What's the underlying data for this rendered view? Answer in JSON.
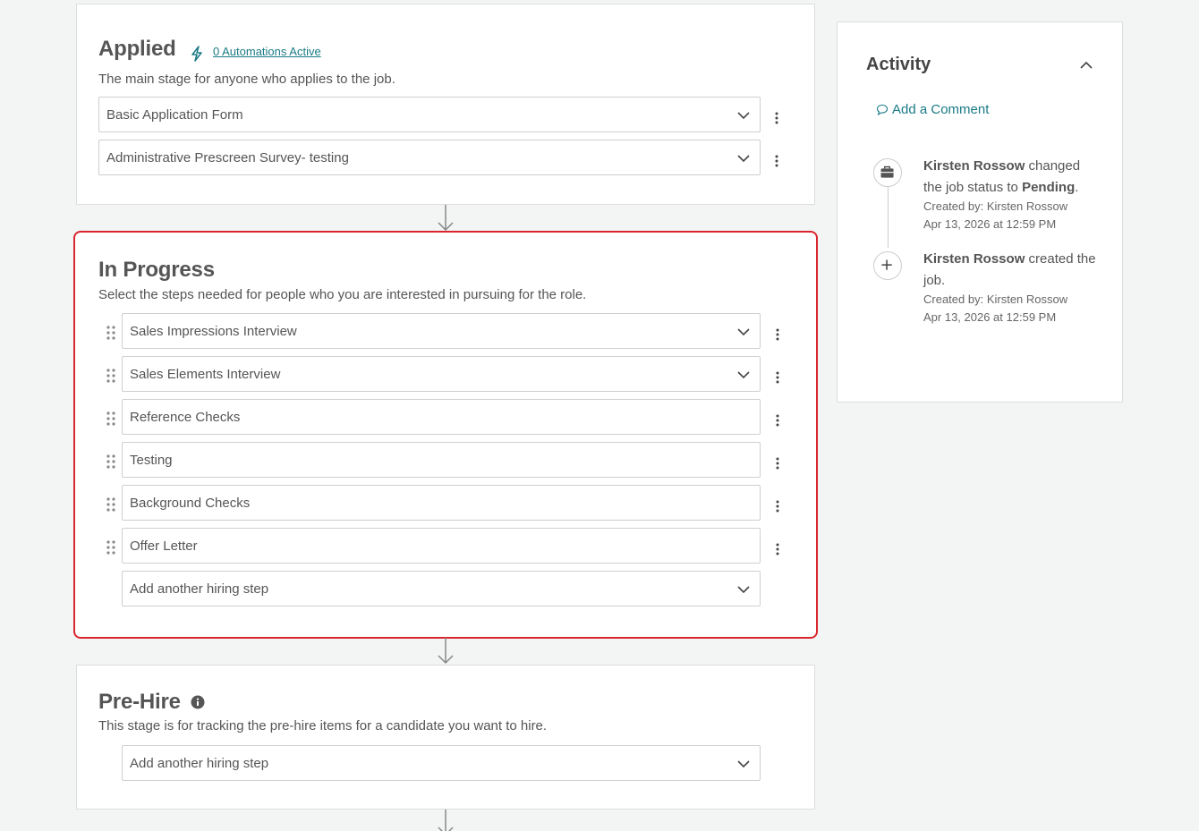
{
  "stages": {
    "applied": {
      "title": "Applied",
      "automations_link": "0 Automations Active",
      "description": "The main stage for anyone who applies to the job.",
      "steps": [
        "Basic Application Form",
        "Administrative Prescreen Survey- testing"
      ]
    },
    "in_progress": {
      "title": "In Progress",
      "description": "Select the steps needed for people who you are interested in pursuing for the role.",
      "steps": [
        "Sales Impressions Interview",
        "Sales Elements Interview",
        "Reference Checks",
        "Testing",
        "Background Checks",
        "Offer Letter"
      ],
      "add_step": "Add another hiring step"
    },
    "pre_hire": {
      "title": "Pre-Hire",
      "description": "This stage is for tracking the pre-hire items for a candidate you want to hire.",
      "add_step": "Add another hiring step"
    }
  },
  "activity": {
    "title": "Activity",
    "add_comment": "Add a Comment",
    "events": [
      {
        "icon": "briefcase-icon",
        "actor": "Kirsten Rossow",
        "action": " changed the job status to ",
        "value": "Pending",
        "suffix": ".",
        "created_by": "Created by: Kirsten Rossow",
        "timestamp": "Apr 13, 2026 at 12:59 PM"
      },
      {
        "icon": "plus-icon",
        "actor": "Kirsten Rossow",
        "action": " created the job.",
        "created_by": "Created by: Kirsten Rossow",
        "timestamp": "Apr 13, 2026 at 12:59 PM"
      }
    ]
  },
  "colors": {
    "accent": "#1a7a86",
    "highlight_border": "#d9262e"
  }
}
